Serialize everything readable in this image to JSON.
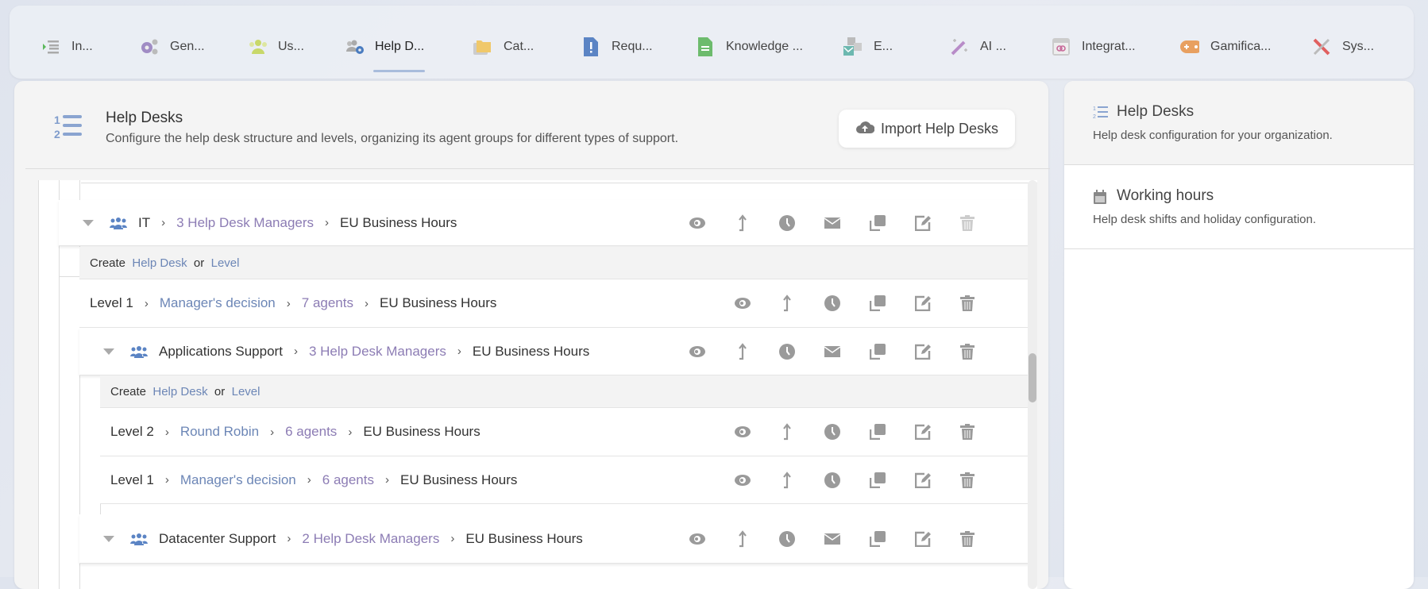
{
  "tabs": [
    {
      "label": "In...",
      "icon": "list-indent-icon",
      "active": false
    },
    {
      "label": "Gen...",
      "icon": "gears-icon",
      "active": false
    },
    {
      "label": "Us...",
      "icon": "users-icon",
      "active": false
    },
    {
      "label": "Help D...",
      "icon": "users-gear-icon",
      "active": true
    },
    {
      "label": "Cat...",
      "icon": "folder-icon",
      "active": false
    },
    {
      "label": "Requ...",
      "icon": "file-exclamation-icon",
      "active": false
    },
    {
      "label": "Knowledge ...",
      "icon": "document-icon",
      "active": false
    },
    {
      "label": "E...",
      "icon": "email-icon",
      "active": false
    },
    {
      "label": "AI ...",
      "icon": "magic-wand-icon",
      "active": false
    },
    {
      "label": "Integrat...",
      "icon": "link-window-icon",
      "active": false
    },
    {
      "label": "Gamifica...",
      "icon": "gamepad-icon",
      "active": false
    },
    {
      "label": "Sys...",
      "icon": "tools-icon",
      "active": false
    }
  ],
  "header": {
    "title": "Help Desks",
    "subtitle": "Configure the help desk structure and levels, organizing its agent groups for different types of support.",
    "import_label": "Import Help Desks"
  },
  "create": {
    "prefix": "Create",
    "help_desk": "Help Desk",
    "or": "or",
    "level": "Level"
  },
  "rows": {
    "it": {
      "name": "IT",
      "managers": "3 Help Desk Managers",
      "hours": "EU Business Hours"
    },
    "it_level1": {
      "name": "Level 1",
      "method": "Manager's decision",
      "agents": "7 agents",
      "hours": "EU Business Hours"
    },
    "apps": {
      "name": "Applications Support",
      "managers": "3 Help Desk Managers",
      "hours": "EU Business Hours"
    },
    "apps_level2": {
      "name": "Level 2",
      "method": "Round Robin",
      "agents": "6 agents",
      "hours": "EU Business Hours"
    },
    "apps_level1": {
      "name": "Level 1",
      "method": "Manager's decision",
      "agents": "6 agents",
      "hours": "EU Business Hours"
    },
    "dc": {
      "name": "Datacenter Support",
      "managers": "2 Help Desk Managers",
      "hours": "EU Business Hours"
    }
  },
  "side": {
    "help_desks": {
      "title": "Help Desks",
      "desc": "Help desk configuration for your organization."
    },
    "working_hours": {
      "title": "Working hours",
      "desc": "Help desk shifts and holiday configuration."
    }
  },
  "colors": {
    "link": "#6c86b6",
    "purple": "#8c7cb4",
    "icon": "#9a9a9a"
  }
}
